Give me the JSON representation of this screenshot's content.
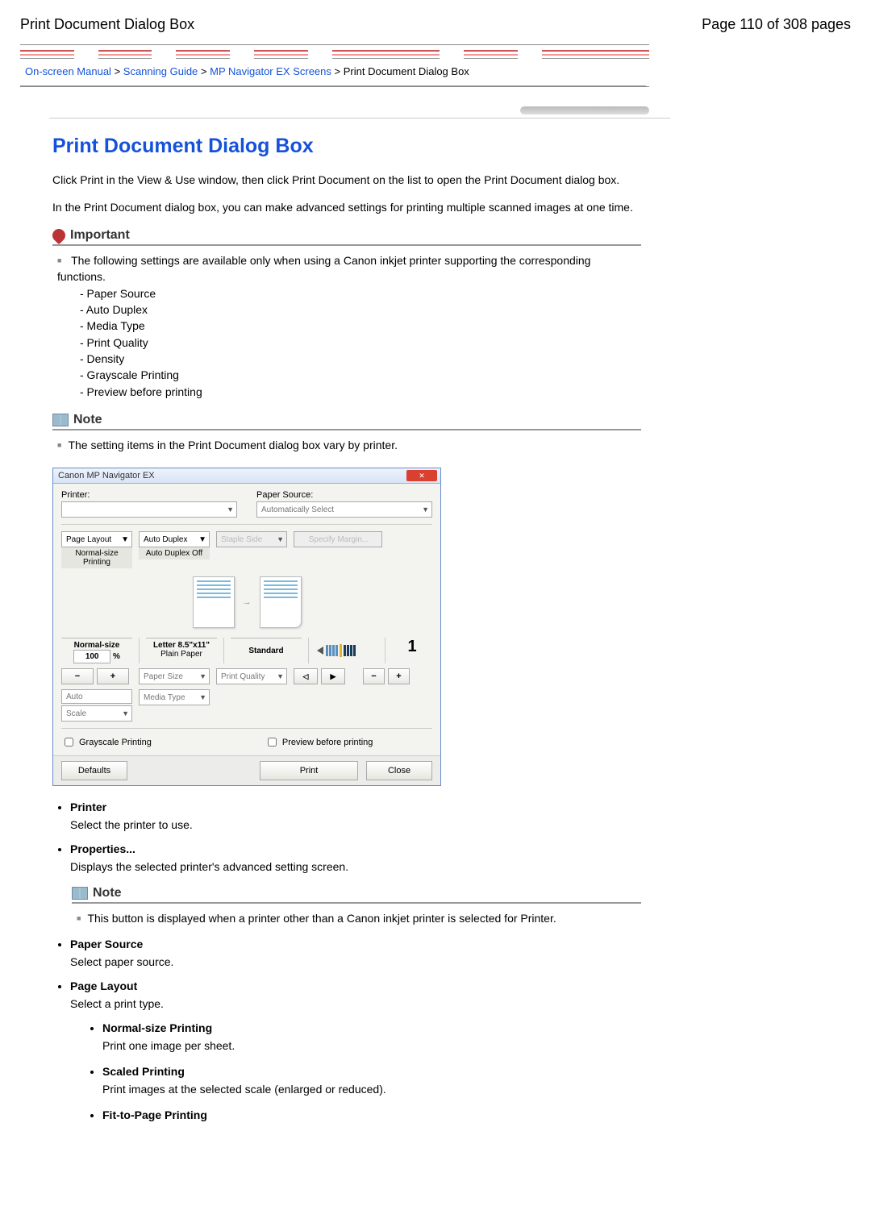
{
  "header": {
    "page_title": "Print Document Dialog Box",
    "page_counter": "Page 110 of 308 pages"
  },
  "breadcrumbs": {
    "b1": "On-screen Manual",
    "b2": "Scanning Guide",
    "b3": "MP Navigator EX Screens",
    "b4": "Print Document Dialog Box"
  },
  "title": "Print Document Dialog Box",
  "intro1": "Click Print in the View & Use window, then click Print Document on the list to open the Print Document dialog box.",
  "intro2": "In the Print Document dialog box, you can make advanced settings for printing multiple scanned images at one time.",
  "important": {
    "heading": "Important",
    "lead": "The following settings are available only when using a Canon inkjet printer supporting the corresponding functions.",
    "items": {
      "i1": "- Paper Source",
      "i2": "- Auto Duplex",
      "i3": "- Media Type",
      "i4": "- Print Quality",
      "i5": "- Density",
      "i6": "- Grayscale Printing",
      "i7": "- Preview before printing"
    }
  },
  "note1": {
    "heading": "Note",
    "text": "The setting items in the Print Document dialog box vary by printer."
  },
  "dialog": {
    "title": "Canon MP Navigator EX",
    "printer_label": "Printer:",
    "paper_source_label": "Paper Source:",
    "paper_source_value": "Automatically Select",
    "page_layout_label": "Page Layout",
    "auto_duplex_label": "Auto Duplex",
    "staple_side_label": "Staple Side",
    "specify_margin_label": "Specify Margin...",
    "normal_caption": "Normal-size Printing",
    "duplex_caption": "Auto Duplex Off",
    "normal_label": "Normal-size",
    "scale_value": "100",
    "scale_unit": "%",
    "letter_label": "Letter 8.5\"x11\"",
    "plain_label": "Plain Paper",
    "standard_label": "Standard",
    "copies_value": "1",
    "minus": "−",
    "plus": "+",
    "paper_size_label": "Paper Size",
    "print_quality_label": "Print Quality",
    "auto_label": "Auto",
    "media_type_label": "Media Type",
    "scale_label": "Scale",
    "grayscale_chk": "Grayscale Printing",
    "preview_chk": "Preview before printing",
    "defaults_btn": "Defaults",
    "print_btn": "Print",
    "close_btn": "Close"
  },
  "defs": {
    "printer": {
      "term": "Printer",
      "desc": "Select the printer to use."
    },
    "properties": {
      "term": "Properties...",
      "desc": "Displays the selected printer's advanced setting screen."
    },
    "properties_note_heading": "Note",
    "properties_note_text": "This button is displayed when a printer other than a Canon inkjet printer is selected for Printer.",
    "paper_source": {
      "term": "Paper Source",
      "desc": "Select paper source."
    },
    "page_layout": {
      "term": "Page Layout",
      "desc": "Select a print type."
    },
    "pl_normal": {
      "term": "Normal-size Printing",
      "desc": "Print one image per sheet."
    },
    "pl_scaled": {
      "term": "Scaled Printing",
      "desc": "Print images at the selected scale (enlarged or reduced)."
    },
    "pl_fit": {
      "term": "Fit-to-Page Printing"
    }
  }
}
